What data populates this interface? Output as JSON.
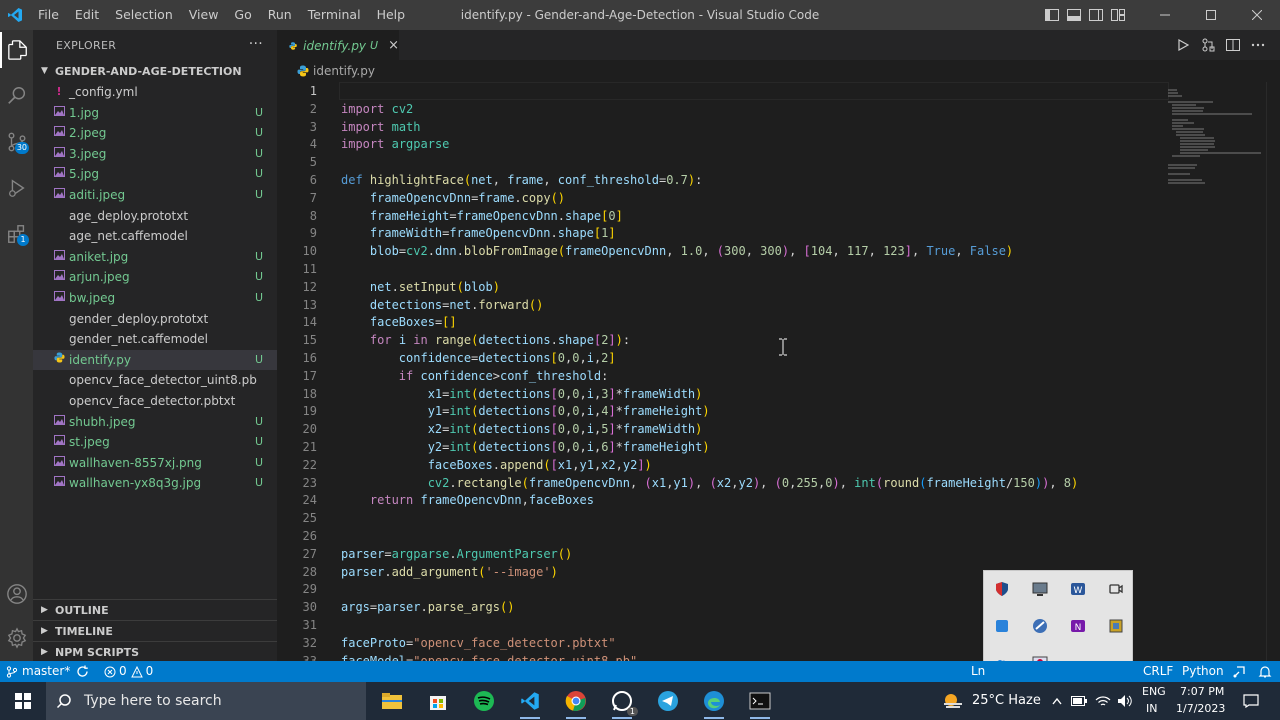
{
  "menu": [
    "File",
    "Edit",
    "Selection",
    "View",
    "Go",
    "Run",
    "Terminal",
    "Help"
  ],
  "window_title": "identify.py - Gender-and-Age-Detection - Visual Studio Code",
  "activity": {
    "scm_badge": "30",
    "extensions_badge": "1"
  },
  "explorer": {
    "title": "EXPLORER",
    "more": "···",
    "folder": "GENDER-AND-AGE-DETECTION",
    "files": [
      {
        "icon": "!",
        "name": "_config.yml",
        "status": ""
      },
      {
        "icon": "img",
        "name": "1.jpg",
        "status": "U"
      },
      {
        "icon": "img",
        "name": "2.jpeg",
        "status": "U"
      },
      {
        "icon": "img",
        "name": "3.jpeg",
        "status": "U"
      },
      {
        "icon": "img",
        "name": "5.jpg",
        "status": "U"
      },
      {
        "icon": "img",
        "name": "aditi.jpeg",
        "status": "U"
      },
      {
        "icon": "",
        "name": "age_deploy.prototxt",
        "status": ""
      },
      {
        "icon": "",
        "name": "age_net.caffemodel",
        "status": ""
      },
      {
        "icon": "img",
        "name": "aniket.jpg",
        "status": "U"
      },
      {
        "icon": "img",
        "name": "arjun.jpeg",
        "status": "U"
      },
      {
        "icon": "img",
        "name": "bw.jpeg",
        "status": "U"
      },
      {
        "icon": "",
        "name": "gender_deploy.prototxt",
        "status": ""
      },
      {
        "icon": "",
        "name": "gender_net.caffemodel",
        "status": ""
      },
      {
        "icon": "py",
        "name": "identify.py",
        "status": "U"
      },
      {
        "icon": "",
        "name": "opencv_face_detector_uint8.pb",
        "status": ""
      },
      {
        "icon": "",
        "name": "opencv_face_detector.pbtxt",
        "status": ""
      },
      {
        "icon": "img",
        "name": "shubh.jpeg",
        "status": "U"
      },
      {
        "icon": "img",
        "name": "st.jpeg",
        "status": "U"
      },
      {
        "icon": "img",
        "name": "wallhaven-8557xj.png",
        "status": "U"
      },
      {
        "icon": "img",
        "name": "wallhaven-yx8q3g.jpg",
        "status": "U"
      }
    ],
    "sections": [
      "OUTLINE",
      "TIMELINE",
      "NPM SCRIPTS"
    ]
  },
  "tab": {
    "name": "identify.py",
    "status": "U",
    "close": "×"
  },
  "breadcrumb": "identify.py",
  "editor": {
    "current_line": 1,
    "lines": [
      {
        "n": "1",
        "h": ""
      },
      {
        "n": "2",
        "h": "<span class=\"kc\">import</span> <span class=\"bi\">cv2</span>"
      },
      {
        "n": "3",
        "h": "<span class=\"kc\">import</span> <span class=\"bi\">math</span>"
      },
      {
        "n": "4",
        "h": "<span class=\"kc\">import</span> <span class=\"bi\">argparse</span>"
      },
      {
        "n": "5",
        "h": ""
      },
      {
        "n": "6",
        "h": "<span class=\"kw\">def</span> <span class=\"fn\">highlightFace</span><span class=\"br1\">(</span><span class=\"vr\">net</span>, <span class=\"vr\">frame</span>, <span class=\"vr\">conf_threshold</span>=<span class=\"nm\">0.7</span><span class=\"br1\">)</span>:"
      },
      {
        "n": "7",
        "h": "    <span class=\"vr\">frameOpencvDnn</span>=<span class=\"vr\">frame</span>.<span class=\"fn\">copy</span><span class=\"br1\">()</span>"
      },
      {
        "n": "8",
        "h": "    <span class=\"vr\">frameHeight</span>=<span class=\"vr\">frameOpencvDnn</span>.<span class=\"vr\">shape</span><span class=\"br1\">[</span><span class=\"nm\">0</span><span class=\"br1\">]</span>"
      },
      {
        "n": "9",
        "h": "    <span class=\"vr\">frameWidth</span>=<span class=\"vr\">frameOpencvDnn</span>.<span class=\"vr\">shape</span><span class=\"br1\">[</span><span class=\"nm\">1</span><span class=\"br1\">]</span>"
      },
      {
        "n": "10",
        "h": "    <span class=\"vr\">blob</span>=<span class=\"bi\">cv2</span>.<span class=\"vr\">dnn</span>.<span class=\"fn\">blobFromImage</span><span class=\"br1\">(</span><span class=\"vr\">frameOpencvDnn</span>, <span class=\"nm\">1.0</span>, <span class=\"br2\">(</span><span class=\"nm\">300</span>, <span class=\"nm\">300</span><span class=\"br2\">)</span>, <span class=\"br2\">[</span><span class=\"nm\">104</span>, <span class=\"nm\">117</span>, <span class=\"nm\">123</span><span class=\"br2\">]</span>, <span class=\"kw\">True</span>, <span class=\"kw\">False</span><span class=\"br1\">)</span>"
      },
      {
        "n": "11",
        "h": ""
      },
      {
        "n": "12",
        "h": "    <span class=\"vr\">net</span>.<span class=\"fn\">setInput</span><span class=\"br1\">(</span><span class=\"vr\">blob</span><span class=\"br1\">)</span>"
      },
      {
        "n": "13",
        "h": "    <span class=\"vr\">detections</span>=<span class=\"vr\">net</span>.<span class=\"fn\">forward</span><span class=\"br1\">()</span>"
      },
      {
        "n": "14",
        "h": "    <span class=\"vr\">faceBoxes</span>=<span class=\"br1\">[]</span>"
      },
      {
        "n": "15",
        "h": "    <span class=\"kc\">for</span> <span class=\"vr\">i</span> <span class=\"kc\">in</span> <span class=\"fn\">range</span><span class=\"br1\">(</span><span class=\"vr\">detections</span>.<span class=\"vr\">shape</span><span class=\"br2\">[</span><span class=\"nm\">2</span><span class=\"br2\">]</span><span class=\"br1\">)</span>:"
      },
      {
        "n": "16",
        "h": "        <span class=\"vr\">confidence</span>=<span class=\"vr\">detections</span><span class=\"br1\">[</span><span class=\"nm\">0</span>,<span class=\"nm\">0</span>,<span class=\"vr\">i</span>,<span class=\"nm\">2</span><span class=\"br1\">]</span>"
      },
      {
        "n": "17",
        "h": "        <span class=\"kc\">if</span> <span class=\"vr\">confidence</span>&gt;<span class=\"vr\">conf_threshold</span>:"
      },
      {
        "n": "18",
        "h": "            <span class=\"vr\">x1</span>=<span class=\"bi\">int</span><span class=\"br1\">(</span><span class=\"vr\">detections</span><span class=\"br2\">[</span><span class=\"nm\">0</span>,<span class=\"nm\">0</span>,<span class=\"vr\">i</span>,<span class=\"nm\">3</span><span class=\"br2\">]</span>*<span class=\"vr\">frameWidth</span><span class=\"br1\">)</span>"
      },
      {
        "n": "19",
        "h": "            <span class=\"vr\">y1</span>=<span class=\"bi\">int</span><span class=\"br1\">(</span><span class=\"vr\">detections</span><span class=\"br2\">[</span><span class=\"nm\">0</span>,<span class=\"nm\">0</span>,<span class=\"vr\">i</span>,<span class=\"nm\">4</span><span class=\"br2\">]</span>*<span class=\"vr\">frameHeight</span><span class=\"br1\">)</span>"
      },
      {
        "n": "20",
        "h": "            <span class=\"vr\">x2</span>=<span class=\"bi\">int</span><span class=\"br1\">(</span><span class=\"vr\">detections</span><span class=\"br2\">[</span><span class=\"nm\">0</span>,<span class=\"nm\">0</span>,<span class=\"vr\">i</span>,<span class=\"nm\">5</span><span class=\"br2\">]</span>*<span class=\"vr\">frameWidth</span><span class=\"br1\">)</span>"
      },
      {
        "n": "21",
        "h": "            <span class=\"vr\">y2</span>=<span class=\"bi\">int</span><span class=\"br1\">(</span><span class=\"vr\">detections</span><span class=\"br2\">[</span><span class=\"nm\">0</span>,<span class=\"nm\">0</span>,<span class=\"vr\">i</span>,<span class=\"nm\">6</span><span class=\"br2\">]</span>*<span class=\"vr\">frameHeight</span><span class=\"br1\">)</span>"
      },
      {
        "n": "22",
        "h": "            <span class=\"vr\">faceBoxes</span>.<span class=\"fn\">append</span><span class=\"br1\">(</span><span class=\"br2\">[</span><span class=\"vr\">x1</span>,<span class=\"vr\">y1</span>,<span class=\"vr\">x2</span>,<span class=\"vr\">y2</span><span class=\"br2\">]</span><span class=\"br1\">)</span>"
      },
      {
        "n": "23",
        "h": "            <span class=\"bi\">cv2</span>.<span class=\"fn\">rectangle</span><span class=\"br1\">(</span><span class=\"vr\">frameOpencvDnn</span>, <span class=\"br2\">(</span><span class=\"vr\">x1</span>,<span class=\"vr\">y1</span><span class=\"br2\">)</span>, <span class=\"br2\">(</span><span class=\"vr\">x2</span>,<span class=\"vr\">y2</span><span class=\"br2\">)</span>, <span class=\"br2\">(</span><span class=\"nm\">0</span>,<span class=\"nm\">255</span>,<span class=\"nm\">0</span><span class=\"br2\">)</span>, <span class=\"bi\">int</span><span class=\"br2\">(</span><span class=\"fn\">round</span><span class=\"br3\">(</span><span class=\"vr\">frameHeight</span>/<span class=\"nm\">150</span><span class=\"br3\">)</span><span class=\"br2\">)</span>, <span class=\"nm\">8</span><span class=\"br1\">)</span>"
      },
      {
        "n": "24",
        "h": "    <span class=\"kc\">return</span> <span class=\"vr\">frameOpencvDnn</span>,<span class=\"vr\">faceBoxes</span>"
      },
      {
        "n": "25",
        "h": ""
      },
      {
        "n": "26",
        "h": ""
      },
      {
        "n": "27",
        "h": "<span class=\"vr\">parser</span>=<span class=\"bi\">argparse</span>.<span class=\"bi\">ArgumentParser</span><span class=\"br1\">()</span>"
      },
      {
        "n": "28",
        "h": "<span class=\"vr\">parser</span>.<span class=\"fn\">add_argument</span><span class=\"br1\">(</span><span class=\"st\">'--image'</span><span class=\"br1\">)</span>"
      },
      {
        "n": "29",
        "h": ""
      },
      {
        "n": "30",
        "h": "<span class=\"vr\">args</span>=<span class=\"vr\">parser</span>.<span class=\"fn\">parse_args</span><span class=\"br1\">()</span>"
      },
      {
        "n": "31",
        "h": ""
      },
      {
        "n": "32",
        "h": "<span class=\"vr\">faceProto</span>=<span class=\"st\">\"opencv_face_detector.pbtxt\"</span>"
      },
      {
        "n": "33",
        "h": "<span class=\"vr\">faceModel</span>=<span class=\"st\">\"opencv_face_detector_uint8.pb\"</span>"
      }
    ]
  },
  "statusbar": {
    "branch": "master*",
    "errors": "0",
    "warnings": "0",
    "ln": "Ln",
    "eol": "CRLF",
    "language": "Python"
  },
  "taskbar": {
    "search_placeholder": "Type here to search",
    "weather": "25°C  Haze",
    "lang1": "ENG",
    "lang2": "IN",
    "time": "7:07 PM",
    "date": "1/7/2023",
    "whatsapp_badge": "1"
  }
}
